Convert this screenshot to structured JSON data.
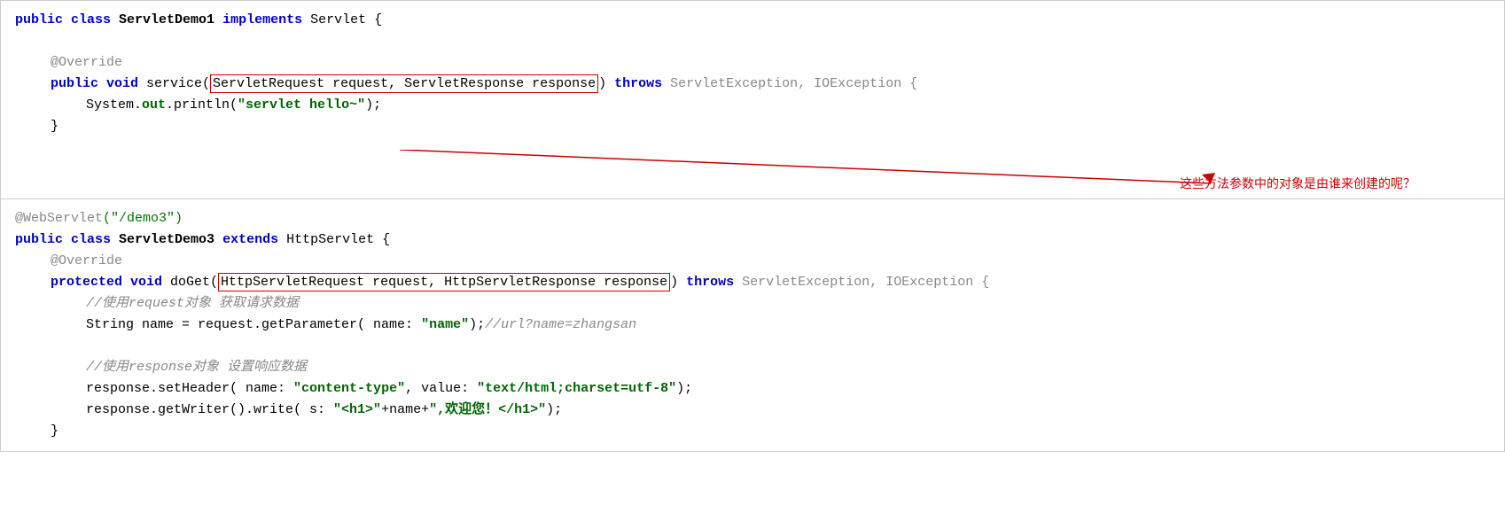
{
  "block1": {
    "lines": [
      {
        "id": "b1l1",
        "parts": [
          {
            "text": "public ",
            "class": "kw-blue"
          },
          {
            "text": "class ",
            "class": "kw-blue"
          },
          {
            "text": "ServletDemo1 ",
            "class": "kw-black-bold"
          },
          {
            "text": "implements ",
            "class": "kw-blue"
          },
          {
            "text": "Servlet {",
            "class": ""
          }
        ]
      },
      {
        "id": "b1l2",
        "parts": [
          {
            "text": "",
            "class": ""
          }
        ]
      },
      {
        "id": "b1l3",
        "indent": 1,
        "parts": [
          {
            "text": "@Override",
            "class": "kw-annotation"
          }
        ]
      },
      {
        "id": "b1l4",
        "indent": 1,
        "parts": [
          {
            "text": "public ",
            "class": "kw-blue"
          },
          {
            "text": "void ",
            "class": "kw-blue"
          },
          {
            "text": "service(",
            "class": ""
          },
          {
            "text": "HIGHLIGHT_START",
            "class": "highlight"
          },
          {
            "text": "ServletRequest request, ServletResponse response",
            "class": ""
          },
          {
            "text": "HIGHLIGHT_END",
            "class": "highlight"
          },
          {
            "text": ") ",
            "class": ""
          },
          {
            "text": "throws ",
            "class": "kw-blue"
          },
          {
            "text": "ServletException, IOException {",
            "class": "kw-gray"
          }
        ]
      },
      {
        "id": "b1l5",
        "indent": 2,
        "parts": [
          {
            "text": "System.",
            "class": ""
          },
          {
            "text": "out",
            "class": "kw-darkgreen"
          },
          {
            "text": ".println(",
            "class": ""
          },
          {
            "text": "\"servlet hello~\"",
            "class": "kw-string"
          },
          {
            "text": ");",
            "class": ""
          }
        ]
      },
      {
        "id": "b1l6",
        "indent": 1,
        "parts": [
          {
            "text": "}",
            "class": ""
          }
        ]
      }
    ]
  },
  "block2": {
    "lines": [
      {
        "id": "b2l1",
        "parts": [
          {
            "text": "@WebServlet",
            "class": "kw-annotation"
          },
          {
            "text": "(\"/demo3\")",
            "class": "kw-green"
          }
        ]
      },
      {
        "id": "b2l2",
        "parts": [
          {
            "text": "public ",
            "class": "kw-blue"
          },
          {
            "text": "class ",
            "class": "kw-blue"
          },
          {
            "text": "ServletDemo3 ",
            "class": "kw-black-bold"
          },
          {
            "text": "extends ",
            "class": "kw-blue"
          },
          {
            "text": "HttpServlet {",
            "class": ""
          }
        ]
      },
      {
        "id": "b2l3",
        "indent": 1,
        "parts": [
          {
            "text": "@Override",
            "class": "kw-annotation"
          }
        ]
      },
      {
        "id": "b2l4",
        "indent": 1,
        "parts": [
          {
            "text": "protected ",
            "class": "kw-blue"
          },
          {
            "text": "void ",
            "class": "kw-blue"
          },
          {
            "text": "doGet(",
            "class": ""
          },
          {
            "text": "HIGHLIGHT_START",
            "class": "highlight"
          },
          {
            "text": "HttpServletRequest request, HttpServletResponse response",
            "class": ""
          },
          {
            "text": "HIGHLIGHT_END",
            "class": "highlight"
          },
          {
            "text": ") ",
            "class": ""
          },
          {
            "text": "throws ",
            "class": "kw-blue"
          },
          {
            "text": "ServletException, IOException {",
            "class": "kw-gray"
          }
        ]
      },
      {
        "id": "b2l5",
        "indent": 2,
        "parts": [
          {
            "text": "//使用request对象 获取请求数据",
            "class": "kw-comment"
          }
        ]
      },
      {
        "id": "b2l6",
        "indent": 2,
        "parts": [
          {
            "text": "String name = request.getParameter( name: ",
            "class": ""
          },
          {
            "text": "\"name\"",
            "class": "kw-string"
          },
          {
            "text": ");//url?name=zhangsan",
            "class": "kw-comment"
          }
        ]
      },
      {
        "id": "b2l7",
        "parts": [
          {
            "text": "",
            "class": ""
          }
        ]
      },
      {
        "id": "b2l8",
        "indent": 2,
        "parts": [
          {
            "text": "//使用response对象 设置响应数据",
            "class": "kw-comment"
          }
        ]
      },
      {
        "id": "b2l9",
        "indent": 2,
        "parts": [
          {
            "text": "response.setHeader( name: ",
            "class": ""
          },
          {
            "text": "\"content-type\"",
            "class": "kw-string"
          },
          {
            "text": ", value: ",
            "class": ""
          },
          {
            "text": "\"text/html;charset=utf-8\"",
            "class": "kw-string"
          },
          {
            "text": ");",
            "class": ""
          }
        ]
      },
      {
        "id": "b2l10",
        "indent": 2,
        "parts": [
          {
            "text": "response.getWriter().write( s: ",
            "class": ""
          },
          {
            "text": "\"<h1>\"",
            "class": "kw-string"
          },
          {
            "text": "+name+",
            "class": ""
          },
          {
            "text": "\",欢迎您！</h1>\"",
            "class": "kw-string"
          },
          {
            "text": ");",
            "class": ""
          }
        ]
      },
      {
        "id": "b2l11",
        "indent": 1,
        "parts": [
          {
            "text": "}",
            "class": ""
          }
        ]
      }
    ]
  },
  "annotation": {
    "text": "这些方法参数中的对象是由谁来创建的呢？"
  }
}
